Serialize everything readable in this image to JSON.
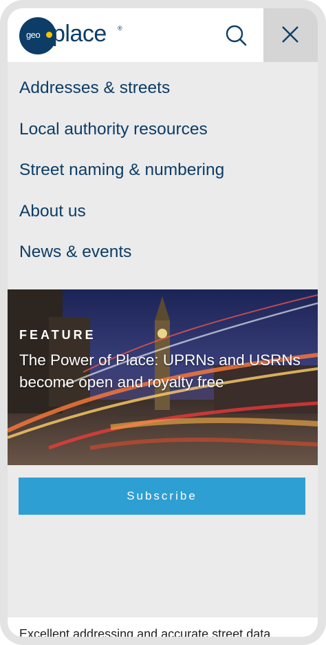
{
  "header": {
    "logo_prefix": "geo",
    "logo_text": "place",
    "logo_mark": "®",
    "brand_color": "#0d3d66",
    "accent_color": "#f5c400",
    "search_icon": "search-icon",
    "close_icon": "close-icon"
  },
  "nav": {
    "items": [
      {
        "label": "Addresses & streets"
      },
      {
        "label": "Local authority resources"
      },
      {
        "label": "Street naming & numbering"
      },
      {
        "label": "About us"
      },
      {
        "label": "News & events"
      }
    ]
  },
  "feature": {
    "label": "FEATURE",
    "title": "The Power of Place: UPRNs and USRNs become open and royalty free"
  },
  "subscribe": {
    "label": "Subscribe",
    "color": "#2e9fd3"
  },
  "footer": {
    "text": "Excellent addressing and accurate street data"
  }
}
